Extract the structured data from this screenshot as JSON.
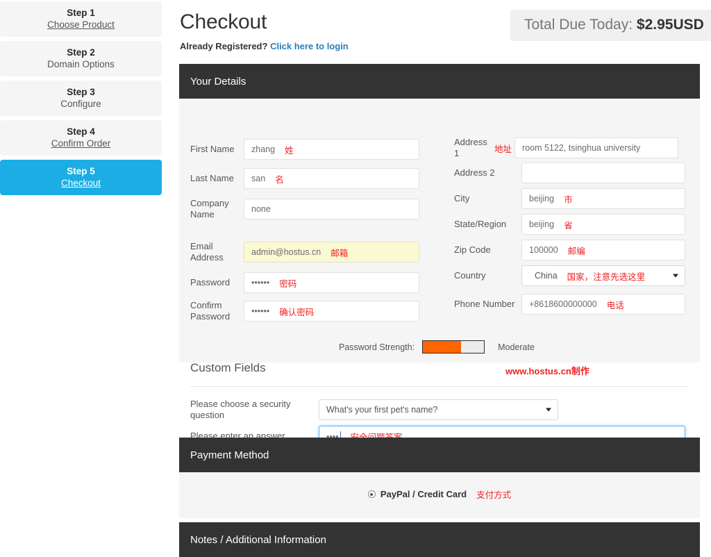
{
  "sidebar": {
    "steps": [
      {
        "num": "Step 1",
        "label": "Choose Product",
        "linked": true,
        "active": false
      },
      {
        "num": "Step 2",
        "label": "Domain Options",
        "linked": false,
        "active": false
      },
      {
        "num": "Step 3",
        "label": "Configure",
        "linked": false,
        "active": false
      },
      {
        "num": "Step 4",
        "label": "Confirm Order",
        "linked": true,
        "active": false
      },
      {
        "num": "Step 5",
        "label": "Checkout",
        "linked": true,
        "active": true
      }
    ]
  },
  "header": {
    "title": "Checkout",
    "already_registered": "Already Registered?",
    "login_link": "Click here to login",
    "total_due_label": "Total Due Today:",
    "total_due_amount": "$2.95USD"
  },
  "details": {
    "panel_title": "Your Details",
    "left_fields": [
      {
        "label": "First Name",
        "value": "zhang",
        "cn": "姓",
        "highlight": false
      },
      {
        "label": "Last Name",
        "value": "san",
        "cn": "名",
        "highlight": false
      },
      {
        "label": "Company Name",
        "value": "none",
        "cn": "",
        "highlight": false
      },
      {
        "label": "Email Address",
        "value": "admin@hostus.cn",
        "cn": "邮箱",
        "highlight": true
      },
      {
        "label": "Password",
        "value": "••••••",
        "cn": "密码",
        "highlight": false
      },
      {
        "label": "Confirm Password",
        "value": "••••••",
        "cn": "确认密码",
        "highlight": false
      }
    ],
    "right_fields": [
      {
        "label": "Address 1",
        "value": "room 5122, tsinghua university",
        "cn": "地址",
        "cn_before": true
      },
      {
        "label": "Address 2",
        "value": "",
        "cn": "",
        "cn_before": false
      },
      {
        "label": "City",
        "value": "beijing",
        "cn": "市",
        "cn_before": false
      },
      {
        "label": "State/Region",
        "value": "beijing",
        "cn": "省",
        "cn_before": false
      },
      {
        "label": "Zip Code",
        "value": "100000",
        "cn": "邮编",
        "cn_before": false
      }
    ],
    "country": {
      "label": "Country",
      "value": "China",
      "cn": "国家，注意先选这里",
      "arrow_icon": "chevron-down-icon"
    },
    "phone": {
      "label": "Phone Number",
      "value": "+8618600000000",
      "cn": "电话"
    },
    "password_strength": {
      "label": "Password Strength:",
      "percent": 62,
      "text": "Moderate",
      "fill_color": "#ff6600"
    }
  },
  "custom_fields": {
    "title": "Custom Fields",
    "watermark": "www.hostus.cn制作",
    "question_label": "Please choose a security question",
    "question_value": "What's your first pet's name?",
    "answer_label": "Please enter an answer",
    "answer_value": "••••",
    "answer_cn": "安全问题答案"
  },
  "payment": {
    "panel_title": "Payment Method",
    "option_label": "PayPal / Credit Card",
    "option_cn": "支付方式"
  },
  "notes": {
    "panel_title": "Notes / Additional Information"
  },
  "colors": {
    "accent": "#1cade4",
    "panel_header": "#333333",
    "annotation": "#ee2222",
    "strength_bar": "#ff6600",
    "link": "#2a7fbb"
  }
}
